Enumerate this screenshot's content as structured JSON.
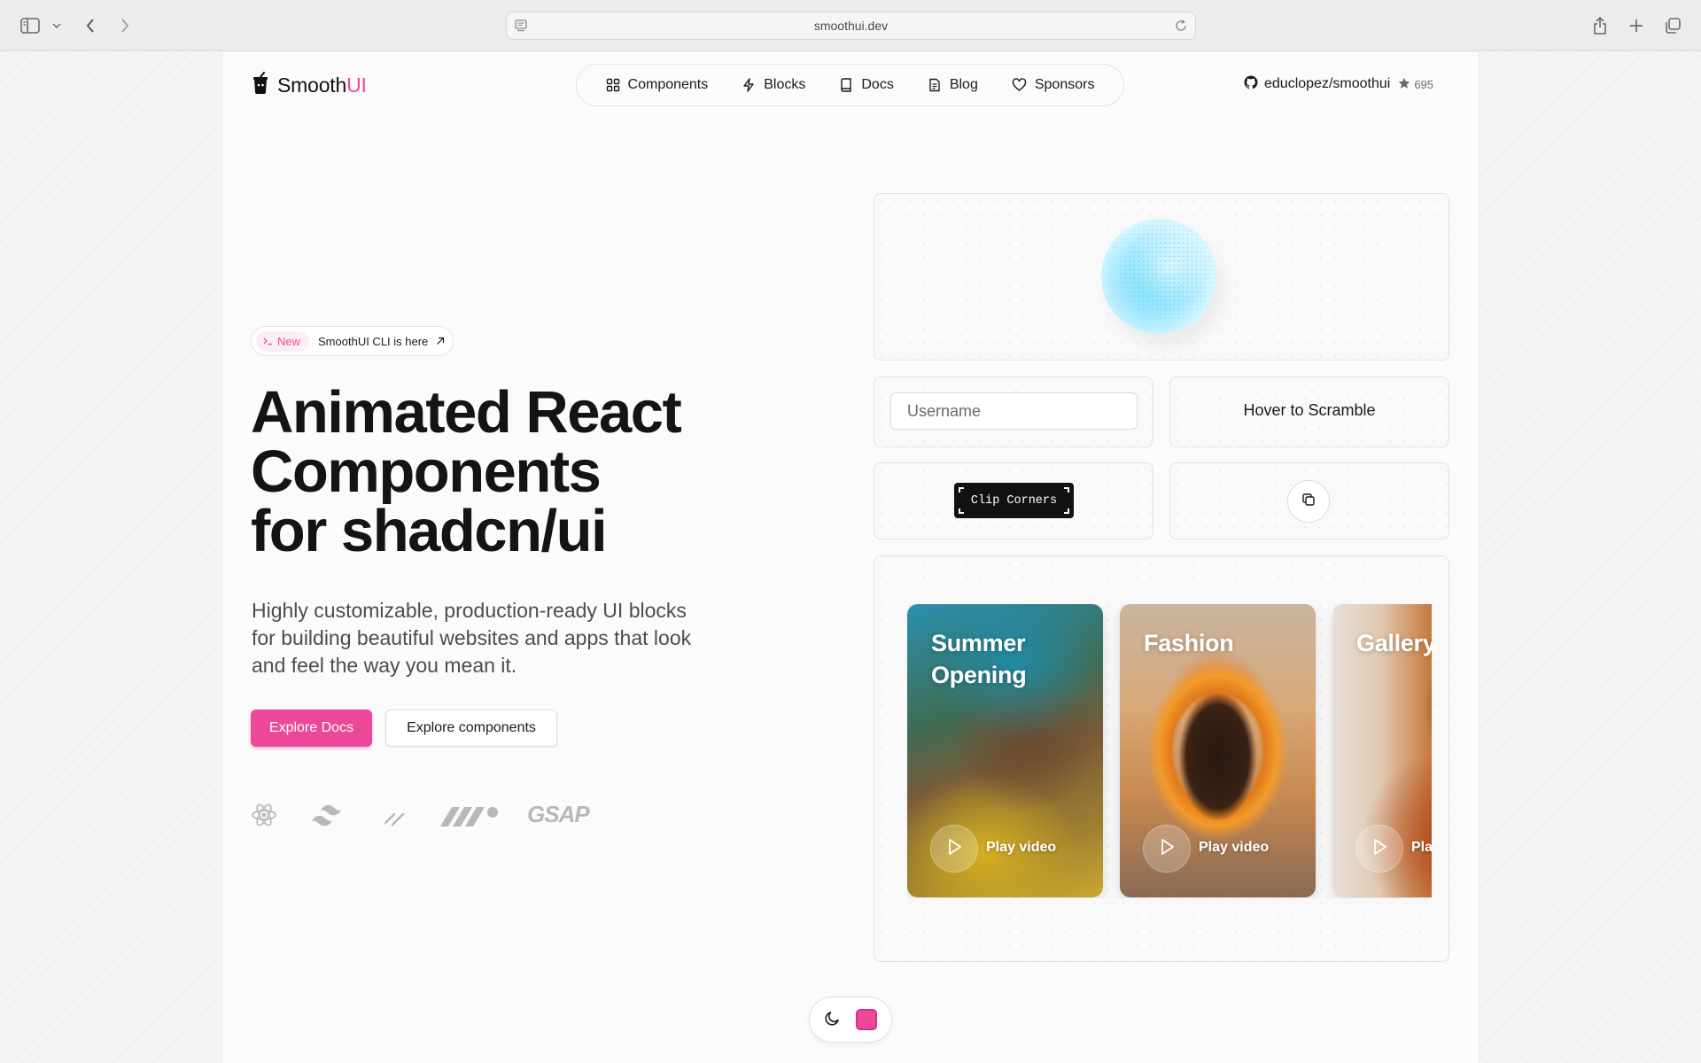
{
  "browser": {
    "url": "smoothui.dev",
    "icons": [
      "sidebar-icon",
      "chevron-down-icon",
      "back-icon",
      "forward-icon",
      "reader-icon",
      "reload-icon",
      "share-icon",
      "new-tab-icon",
      "tabs-overview-icon"
    ]
  },
  "header": {
    "logo_prefix": "Smooth",
    "logo_accent": "UI",
    "nav": [
      {
        "label": "Components",
        "icon": "grid-icon"
      },
      {
        "label": "Blocks",
        "icon": "bolt-icon"
      },
      {
        "label": "Docs",
        "icon": "book-icon"
      },
      {
        "label": "Blog",
        "icon": "document-icon"
      },
      {
        "label": "Sponsors",
        "icon": "heart-icon"
      }
    ],
    "repo": "educlopez/smoothui",
    "stars": "695"
  },
  "hero": {
    "badge_tag": "New",
    "badge_text": "SmoothUI CLI is here",
    "title_line1": "Animated React",
    "title_line2": "Components",
    "title_line3": "for shadcn/ui",
    "subtitle": "Highly customizable, production-ready UI blocks for building beautiful websites and apps that look and feel the way you mean it.",
    "primary_cta": "Explore Docs",
    "secondary_cta": "Explore components",
    "tech_logos": [
      "react-icon",
      "tailwind-icon",
      "shadcn-icon",
      "motion-icon",
      "gsap-logo"
    ],
    "gsap_label": "GSAP"
  },
  "demos": {
    "username_placeholder": "Username",
    "scramble_label": "Hover to Scramble",
    "clip_label": "Clip Corners",
    "copy_icon": "copy-icon",
    "videos": [
      {
        "title": "Summer Opening",
        "play_label": "Play video"
      },
      {
        "title": "Fashion",
        "play_label": "Play video"
      },
      {
        "title": "Gallery",
        "play_label": "Play video"
      }
    ]
  },
  "theme": {
    "mode_icon": "moon-icon",
    "accent_color": "#ec4899"
  },
  "colors": {
    "accent": "#ec4899",
    "text": "#141414",
    "muted": "#4d4d4d"
  }
}
